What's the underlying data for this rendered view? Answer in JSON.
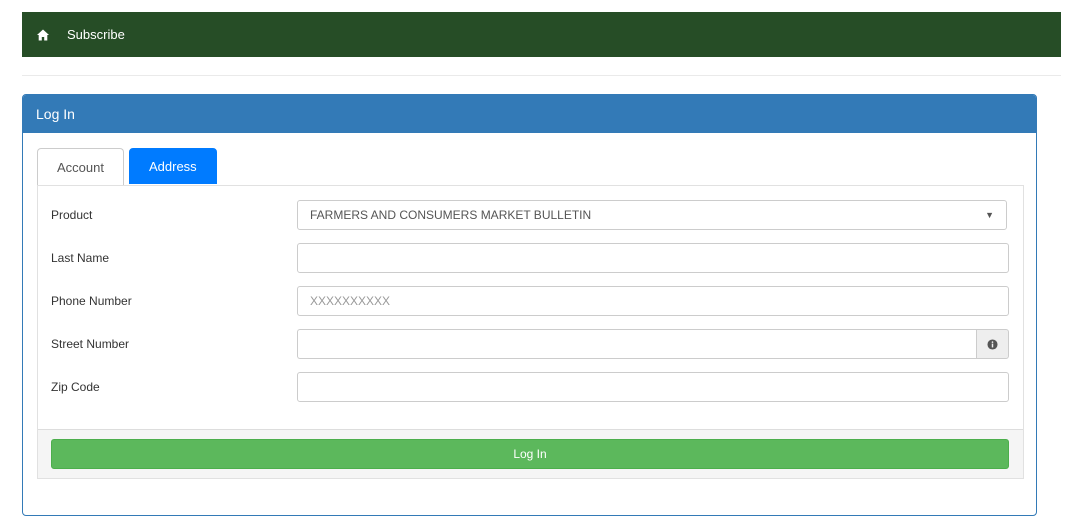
{
  "nav": {
    "home_icon": "home-icon",
    "subscribe_label": "Subscribe",
    "bg_color": "#264d26"
  },
  "panel": {
    "title": "Log In",
    "accent_color": "#337ab7"
  },
  "tabs": [
    {
      "label": "Account",
      "active": false
    },
    {
      "label": "Address",
      "active": true
    }
  ],
  "form": {
    "product": {
      "label": "Product",
      "value": "FARMERS AND CONSUMERS MARKET BULLETIN"
    },
    "last_name": {
      "label": "Last Name",
      "value": "",
      "placeholder": ""
    },
    "phone": {
      "label": "Phone Number",
      "value": "",
      "placeholder": "XXXXXXXXXX"
    },
    "street": {
      "label": "Street Number",
      "value": "",
      "placeholder": "",
      "info_icon": "info-circle-icon"
    },
    "zip": {
      "label": "Zip Code",
      "value": "",
      "placeholder": ""
    }
  },
  "submit": {
    "label": "Log In",
    "color": "#5cb85c"
  }
}
